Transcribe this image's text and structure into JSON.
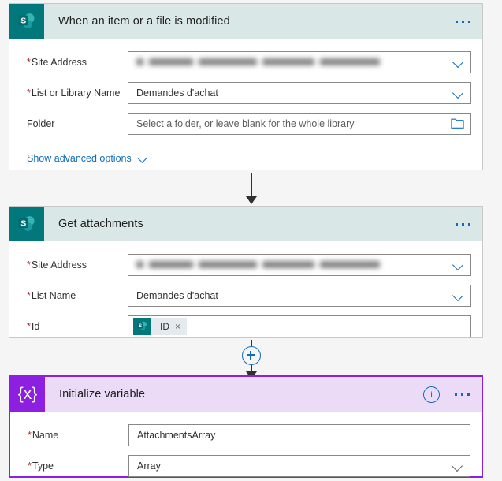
{
  "theme": {
    "page_bg": "#f5f5f5",
    "sharepoint_teal": "#03787c",
    "header_blue_gray": "#d9e7e7",
    "variable_purple": "#8c1fe0",
    "variable_header_bg": "#ecdbf7",
    "link_blue": "#0f6cbd",
    "required_red": "#a4262c"
  },
  "cards": [
    {
      "title": "When an item or a file is modified",
      "icon": "sharepoint-icon",
      "menu_label": "...",
      "fields": [
        {
          "label": "Site Address",
          "required": true,
          "type": "dropdown",
          "value": "",
          "redacted": true
        },
        {
          "label": "List or Library Name",
          "required": true,
          "type": "dropdown",
          "value": "Demandes d'achat",
          "redacted": false
        },
        {
          "label": "Folder",
          "required": false,
          "type": "folder-picker",
          "value": "",
          "placeholder": "Select a folder, or leave blank for the whole library",
          "redacted": false
        }
      ],
      "advanced_options_label": "Show advanced options"
    },
    {
      "title": "Get attachments",
      "icon": "sharepoint-icon",
      "menu_label": "...",
      "fields": [
        {
          "label": "Site Address",
          "required": true,
          "type": "dropdown",
          "value": "",
          "redacted": true
        },
        {
          "label": "List Name",
          "required": true,
          "type": "dropdown",
          "value": "Demandes d'achat",
          "redacted": false
        },
        {
          "label": "Id",
          "required": true,
          "type": "token",
          "token": {
            "label": "ID",
            "icon": "sharepoint-icon",
            "remove_label": "×"
          }
        }
      ]
    },
    {
      "title": "Initialize variable",
      "icon": "variable-icon",
      "icon_text": "{x}",
      "menu_label": "...",
      "info_label": "i",
      "selected": true,
      "fields": [
        {
          "label": "Name",
          "required": true,
          "type": "text",
          "value": "AttachmentsArray"
        },
        {
          "label": "Type",
          "required": true,
          "type": "dropdown",
          "value": "Array"
        }
      ]
    }
  ],
  "connectors": {
    "add_step_label": "+"
  }
}
